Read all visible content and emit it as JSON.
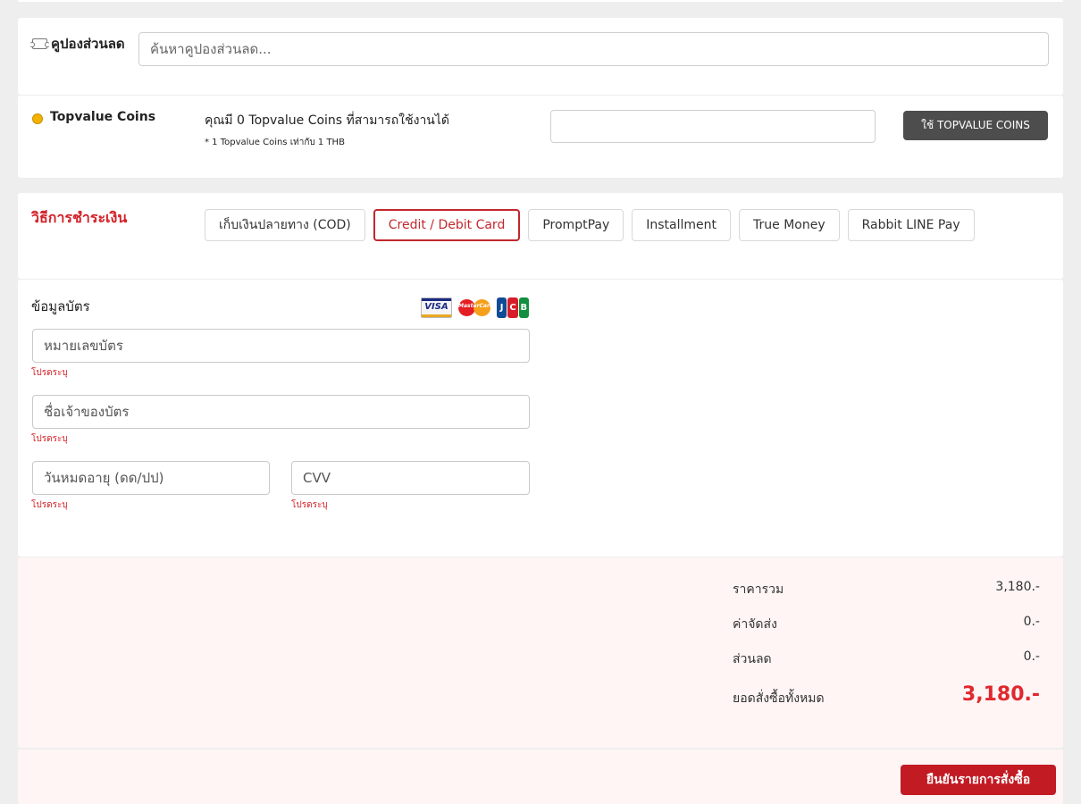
{
  "coupon": {
    "label": "คูปองส่วนลด",
    "icon": "ticket-icon",
    "search_placeholder": "ค้นหาคูปองส่วนลด..."
  },
  "coins": {
    "title": "Topvalue Coins",
    "icon": "coin-icon",
    "available_text": "คุณมี 0 Topvalue Coins ที่สามารถใช้งานได้",
    "note": "* 1 Topvalue Coins เท่ากับ 1 THB",
    "input_value": "",
    "apply_label": "ใช้ TOPVALUE COINS"
  },
  "payment": {
    "title": "วิธีการชำระเงิน",
    "methods": [
      {
        "label": "เก็บเงินปลายทาง (COD)",
        "active": false
      },
      {
        "label": "Credit / Debit Card",
        "active": true
      },
      {
        "label": "PromptPay",
        "active": false
      },
      {
        "label": "Installment",
        "active": false
      },
      {
        "label": "True Money",
        "active": false
      },
      {
        "label": "Rabbit LINE Pay",
        "active": false
      }
    ]
  },
  "card_info": {
    "title": "ข้อมูลบัตร",
    "brands": {
      "visa": "VISA",
      "mastercard": "MasterCard",
      "jcb": [
        "J",
        "C",
        "B"
      ]
    },
    "card_number_placeholder": "หมายเลขบัตร",
    "holder_name_placeholder": "ชื่อเจ้าของบัตร",
    "expiry_placeholder": "วันหมดอายุ (ดด/ปป)",
    "cvv_placeholder": "CVV",
    "required_text": "โปรดระบุ"
  },
  "summary": {
    "subtotal_label": "ราคารวม",
    "subtotal_value": "3,180.-",
    "shipping_label": "ค่าจัดส่ง",
    "shipping_value": "0.-",
    "discount_label": "ส่วนลด",
    "discount_value": "0.-",
    "total_label": "ยอดสั่งซื้อทั้งหมด",
    "total_value": "3,180.-"
  },
  "confirm": {
    "label": "ยืนยันรายการสั่งซื้อ"
  },
  "colors": {
    "accent": "#d32027",
    "button_dark": "#4d4d4d",
    "summary_bg": "#fff5f5"
  }
}
